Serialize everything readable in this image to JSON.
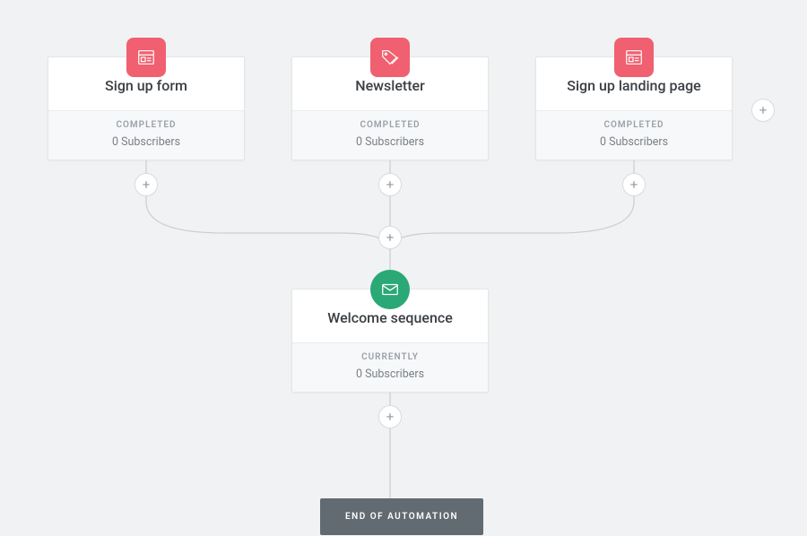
{
  "triggers": [
    {
      "title": "Sign up form",
      "status": "COMPLETED",
      "subscribers": "0 Subscribers",
      "icon": "form"
    },
    {
      "title": "Newsletter",
      "status": "COMPLETED",
      "subscribers": "0 Subscribers",
      "icon": "tag"
    },
    {
      "title": "Sign up landing page",
      "status": "COMPLETED",
      "subscribers": "0 Subscribers",
      "icon": "form"
    }
  ],
  "step": {
    "title": "Welcome sequence",
    "status": "CURRENTLY",
    "subscribers": "0 Subscribers",
    "icon": "mail"
  },
  "end_label": "END OF AUTOMATION",
  "colors": {
    "trigger_badge": "#f06070",
    "step_badge": "#2aa876",
    "end_block": "#626a72"
  }
}
